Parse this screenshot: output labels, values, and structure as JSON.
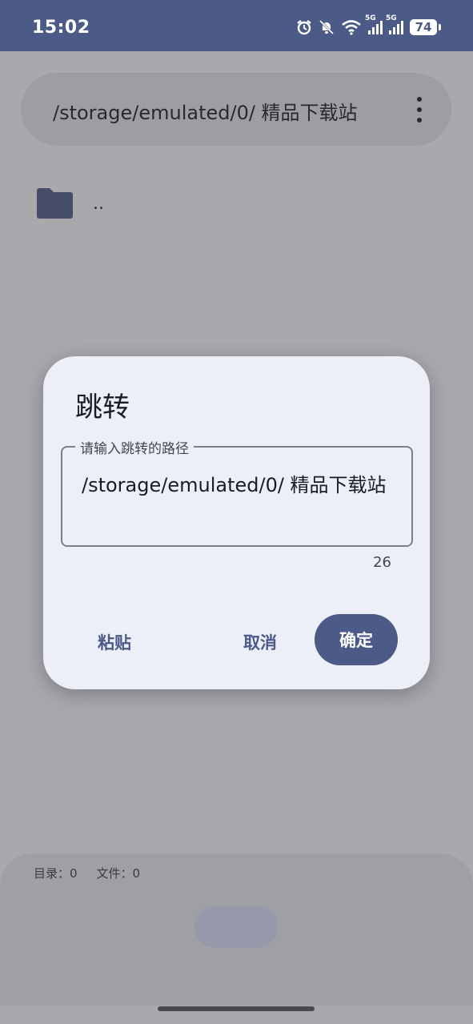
{
  "status_bar": {
    "time": "15:02",
    "battery": "74",
    "network_tag_1": "5G",
    "network_tag_2": "5G",
    "icons": [
      "alarm-icon",
      "bell-off-icon",
      "wifi-icon",
      "signal-icon",
      "signal-icon",
      "battery-icon"
    ]
  },
  "header": {
    "path": "/storage/emulated/0/ 精品下载站",
    "menu_icon": "more-vert-icon"
  },
  "file_list": {
    "items": [
      {
        "name": "..",
        "icon": "folder-icon"
      }
    ]
  },
  "bottom_bar": {
    "dir_count": "目录：0",
    "file_count": "文件：0"
  },
  "dialog": {
    "title": "跳转",
    "input_label": "请输入跳转的路径",
    "input_value": "/storage/emulated/0/ 精品下载站",
    "char_count": "26",
    "paste_label": "粘贴",
    "cancel_label": "取消",
    "ok_label": "确定"
  },
  "colors": {
    "primary": "#4c5a87",
    "dialog_bg": "#eceef8",
    "surface": "#e3e4ec"
  }
}
